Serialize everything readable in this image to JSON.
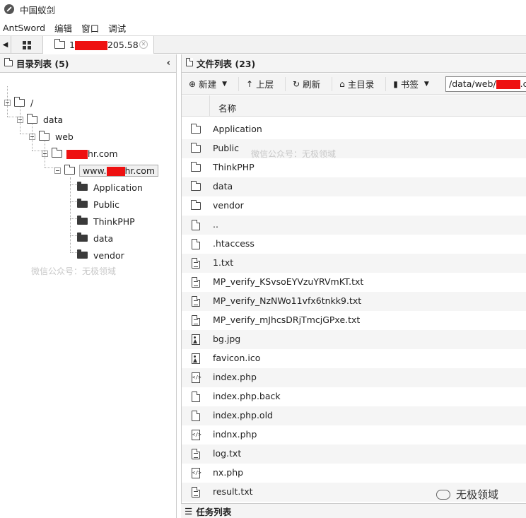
{
  "window": {
    "title": "中国蚁剑"
  },
  "menu": [
    "AntSword",
    "编辑",
    "窗口",
    "调试"
  ],
  "tabs": {
    "site_prefix": "1",
    "site_suffix": "205.58"
  },
  "dir_panel": {
    "title": "目录列表 (5)",
    "tree": {
      "root": "/",
      "data": "data",
      "web": "web",
      "domain_suffix": "hr.com",
      "selected_prefix": "www.",
      "selected_suffix": "hr.com",
      "children": [
        "Application",
        "Public",
        "ThinkPHP",
        "data",
        "vendor"
      ]
    }
  },
  "file_panel": {
    "title": "文件列表 (23)",
    "toolbar": {
      "new": "新建",
      "up": "上层",
      "refresh": "刷新",
      "home": "主目录",
      "bookmark": "书签",
      "path_prefix": "/data/web/",
      "path_suffix": ".co"
    },
    "column_name": "名称",
    "files": [
      {
        "name": "Application",
        "type": "folder"
      },
      {
        "name": "Public",
        "type": "folder"
      },
      {
        "name": "ThinkPHP",
        "type": "folder"
      },
      {
        "name": "data",
        "type": "folder"
      },
      {
        "name": "vendor",
        "type": "folder"
      },
      {
        "name": "..",
        "type": "file"
      },
      {
        "name": ".htaccess",
        "type": "file"
      },
      {
        "name": "1.txt",
        "type": "text"
      },
      {
        "name": "MP_verify_KSvsoEYVzuYRVmKT.txt",
        "type": "text"
      },
      {
        "name": "MP_verify_NzNWo11vfx6tnkk9.txt",
        "type": "text"
      },
      {
        "name": "MP_verify_mJhcsDRjTmcjGPxe.txt",
        "type": "text"
      },
      {
        "name": "bg.jpg",
        "type": "image"
      },
      {
        "name": "favicon.ico",
        "type": "image"
      },
      {
        "name": "index.php",
        "type": "code"
      },
      {
        "name": "index.php.back",
        "type": "file"
      },
      {
        "name": "index.php.old",
        "type": "file"
      },
      {
        "name": "indnx.php",
        "type": "code"
      },
      {
        "name": "log.txt",
        "type": "text"
      },
      {
        "name": "nx.php",
        "type": "code"
      },
      {
        "name": "result.txt",
        "type": "text"
      }
    ]
  },
  "task_panel": {
    "title": "任务列表"
  },
  "watermarks": {
    "left": "微信公众号：无极领域",
    "right": "微信公众号：无极领域",
    "corner": "无极领域"
  }
}
